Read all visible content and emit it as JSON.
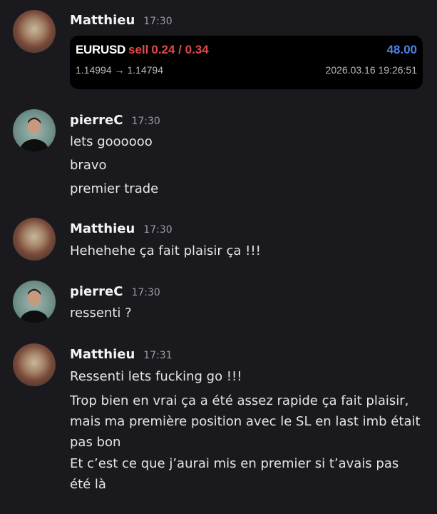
{
  "messages": [
    {
      "user": "Matthieu",
      "time": "17:30",
      "trade": {
        "pair": "EURUSD",
        "side": "sell",
        "lots": "0.24 / 0.34",
        "pnl": "48.00",
        "prices": "1.14994 → 1.14794",
        "datetime": "2026.03.16 19:26:51"
      }
    },
    {
      "user": "pierreC",
      "time": "17:30",
      "lines": [
        "lets goooooo",
        "bravo",
        "premier trade"
      ]
    },
    {
      "user": "Matthieu",
      "time": "17:30",
      "lines": [
        "Hehehehe ça fait plaisir ça !!!"
      ]
    },
    {
      "user": "pierreC",
      "time": "17:30",
      "lines": [
        "ressenti ?"
      ]
    },
    {
      "user": "Matthieu",
      "time": "17:31",
      "lines": [
        "Ressenti lets fucking go !!!",
        "Trop bien en vrai ça a été assez rapide ça fait plaisir, mais ma première position avec le SL en last imb était pas bon",
        "Et c’est ce que j’aurai mis en premier si t’avais pas été là"
      ]
    }
  ]
}
